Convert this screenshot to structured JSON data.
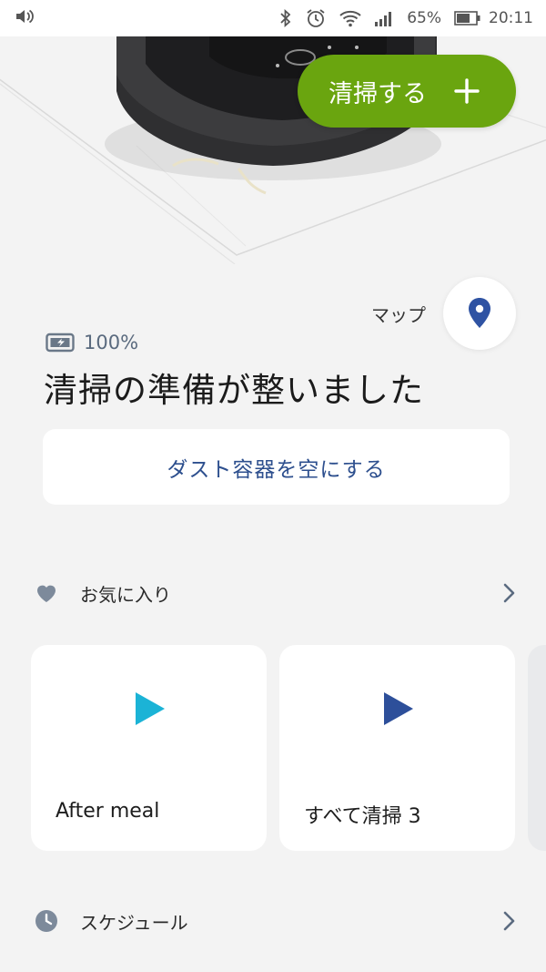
{
  "status_bar": {
    "battery_pct": "65%",
    "time": "20:11",
    "icons": [
      "volume-icon",
      "bluetooth-icon",
      "alarm-icon",
      "wifi-icon",
      "signal-icon",
      "battery-icon"
    ]
  },
  "actions": {
    "clean_label": "清掃する"
  },
  "map": {
    "label": "マップ"
  },
  "robot_status": {
    "battery": "100%",
    "title": "清掃の準備が整いました",
    "empty_bin_label": "ダスト容器を空にする"
  },
  "favorites": {
    "label": "お気に入り",
    "items": [
      {
        "label": "After meal",
        "play_color": "#1bb3d6"
      },
      {
        "label": "すべて清掃 3",
        "play_color": "#2d4f9a"
      }
    ]
  },
  "schedule": {
    "label": "スケジュール"
  },
  "colors": {
    "accent_green": "#6aa50f",
    "link_blue": "#2d4f8e",
    "background": "#f3f3f3"
  }
}
